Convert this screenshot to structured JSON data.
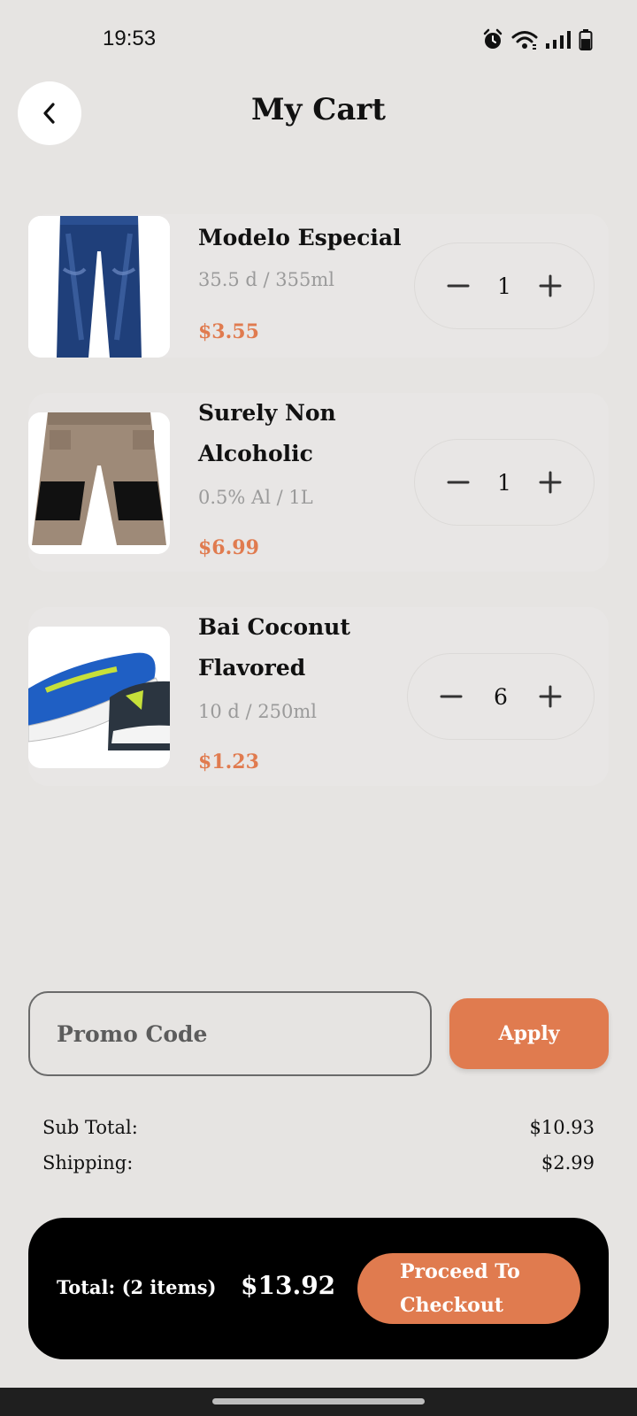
{
  "status_bar": {
    "time": "19:53",
    "icons": [
      "alarm-icon",
      "wifi-icon",
      "signal-icon",
      "battery-icon"
    ]
  },
  "header": {
    "title": "My Cart",
    "back_icon": "chevron-left-icon"
  },
  "cart": {
    "items": [
      {
        "name": "Modelo Especial",
        "volume": "35.5 d / 355ml",
        "price": "$3.55",
        "quantity": "1",
        "image": "blue-jeans-image"
      },
      {
        "name": "Surely Non Alcoholic",
        "volume": "0.5% Al / 1L",
        "price": "$6.99",
        "quantity": "1",
        "image": "work-pants-image"
      },
      {
        "name": "Bai Coconut Flavored",
        "volume": "10 d / 250ml",
        "price": "$1.23",
        "quantity": "6",
        "image": "sneakers-image"
      }
    ]
  },
  "promo": {
    "placeholder": "Promo Code",
    "apply_label": "Apply"
  },
  "summary": {
    "subtotal_label": "Sub Total:",
    "subtotal_value": "$10.93",
    "shipping_label": "Shipping:",
    "shipping_value": "$2.99"
  },
  "total": {
    "label": "Total: (2 items)",
    "amount": "$13.92",
    "checkout_label": "Proceed To Checkout"
  },
  "colors": {
    "accent": "#E07B4F",
    "background": "#E6E4E2",
    "total_bar": "#000000"
  }
}
